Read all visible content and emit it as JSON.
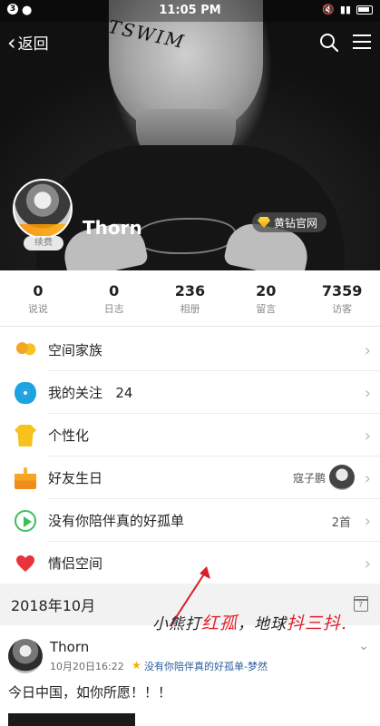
{
  "status_bar": {
    "time": "11:05 PM",
    "left_badge": "3",
    "right_text": "▾ⅰ"
  },
  "nav": {
    "back_label": "返回"
  },
  "cover": {
    "scribble_text": "TSWIM"
  },
  "profile": {
    "name": "Thorn",
    "renew_label": "续费",
    "vip_label": "黄钻官网"
  },
  "stats": [
    {
      "value": "0",
      "label": "说说"
    },
    {
      "value": "0",
      "label": "日志"
    },
    {
      "value": "236",
      "label": "相册"
    },
    {
      "value": "20",
      "label": "留言"
    },
    {
      "value": "7359",
      "label": "访客"
    }
  ],
  "menu": [
    {
      "icon": "family-icon",
      "label": "空间家族",
      "extra": ""
    },
    {
      "icon": "eye-icon",
      "label": "我的关注",
      "count": "24"
    },
    {
      "icon": "shirt-icon",
      "label": "个性化"
    },
    {
      "icon": "cake-icon",
      "label": "好友生日",
      "friend": "寇子鹏"
    },
    {
      "icon": "play-icon",
      "label": "没有你陪伴真的好孤单",
      "extra": "2首"
    },
    {
      "icon": "heart-icon",
      "label": "情侣空间"
    }
  ],
  "month": {
    "label": "2018年10月",
    "calendar_day": "7"
  },
  "watermark": {
    "part1": "小熊打",
    "part2": "红孤",
    "part3": "，地球",
    "part4": "抖三抖",
    "part5": "."
  },
  "post": {
    "name": "Thorn",
    "time": "10月20日16:22",
    "link": "没有你陪伴真的好孤单-梦然",
    "text": "今日中国，如你所愿！！！"
  },
  "colors": {
    "accent_blue": "#1fa2e0",
    "gold": "#f6c21c",
    "heart_red": "#e8323c",
    "play_green": "#3bbf5a",
    "link_blue": "#2b5d9b"
  }
}
